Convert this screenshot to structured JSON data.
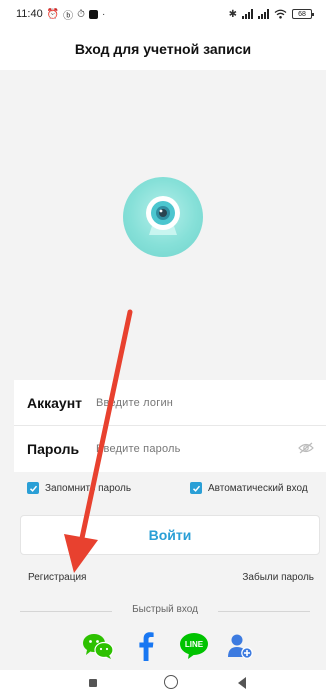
{
  "status_bar": {
    "time": "11:40",
    "battery": "68"
  },
  "header": {
    "title": "Вход для учетной записи"
  },
  "form": {
    "account_label": "Аккаунт",
    "account_placeholder": "Введите логин",
    "account_value": "",
    "password_label": "Пароль",
    "password_placeholder": "Введите пароль",
    "password_value": ""
  },
  "options": {
    "remember_password": "Запомнить пароль",
    "remember_checked": true,
    "auto_login": "Автоматический вход",
    "auto_checked": true
  },
  "login_button": "Войти",
  "links": {
    "register": "Регистрация",
    "forgot": "Забыли пароль"
  },
  "quick_login": {
    "label": "Быстрый вход",
    "providers": [
      "wechat-icon",
      "facebook-icon",
      "line-icon",
      "add-user-icon"
    ]
  },
  "social": {
    "line_text": "LINE"
  },
  "colors": {
    "accent": "#2a9fd6",
    "logo_teal": "#7fdcd3",
    "annotation_arrow": "#e8412f",
    "wechat_green": "#2dc100",
    "facebook_blue": "#1877f2",
    "line_green": "#00c300",
    "adduser_blue": "#3d7be0"
  }
}
